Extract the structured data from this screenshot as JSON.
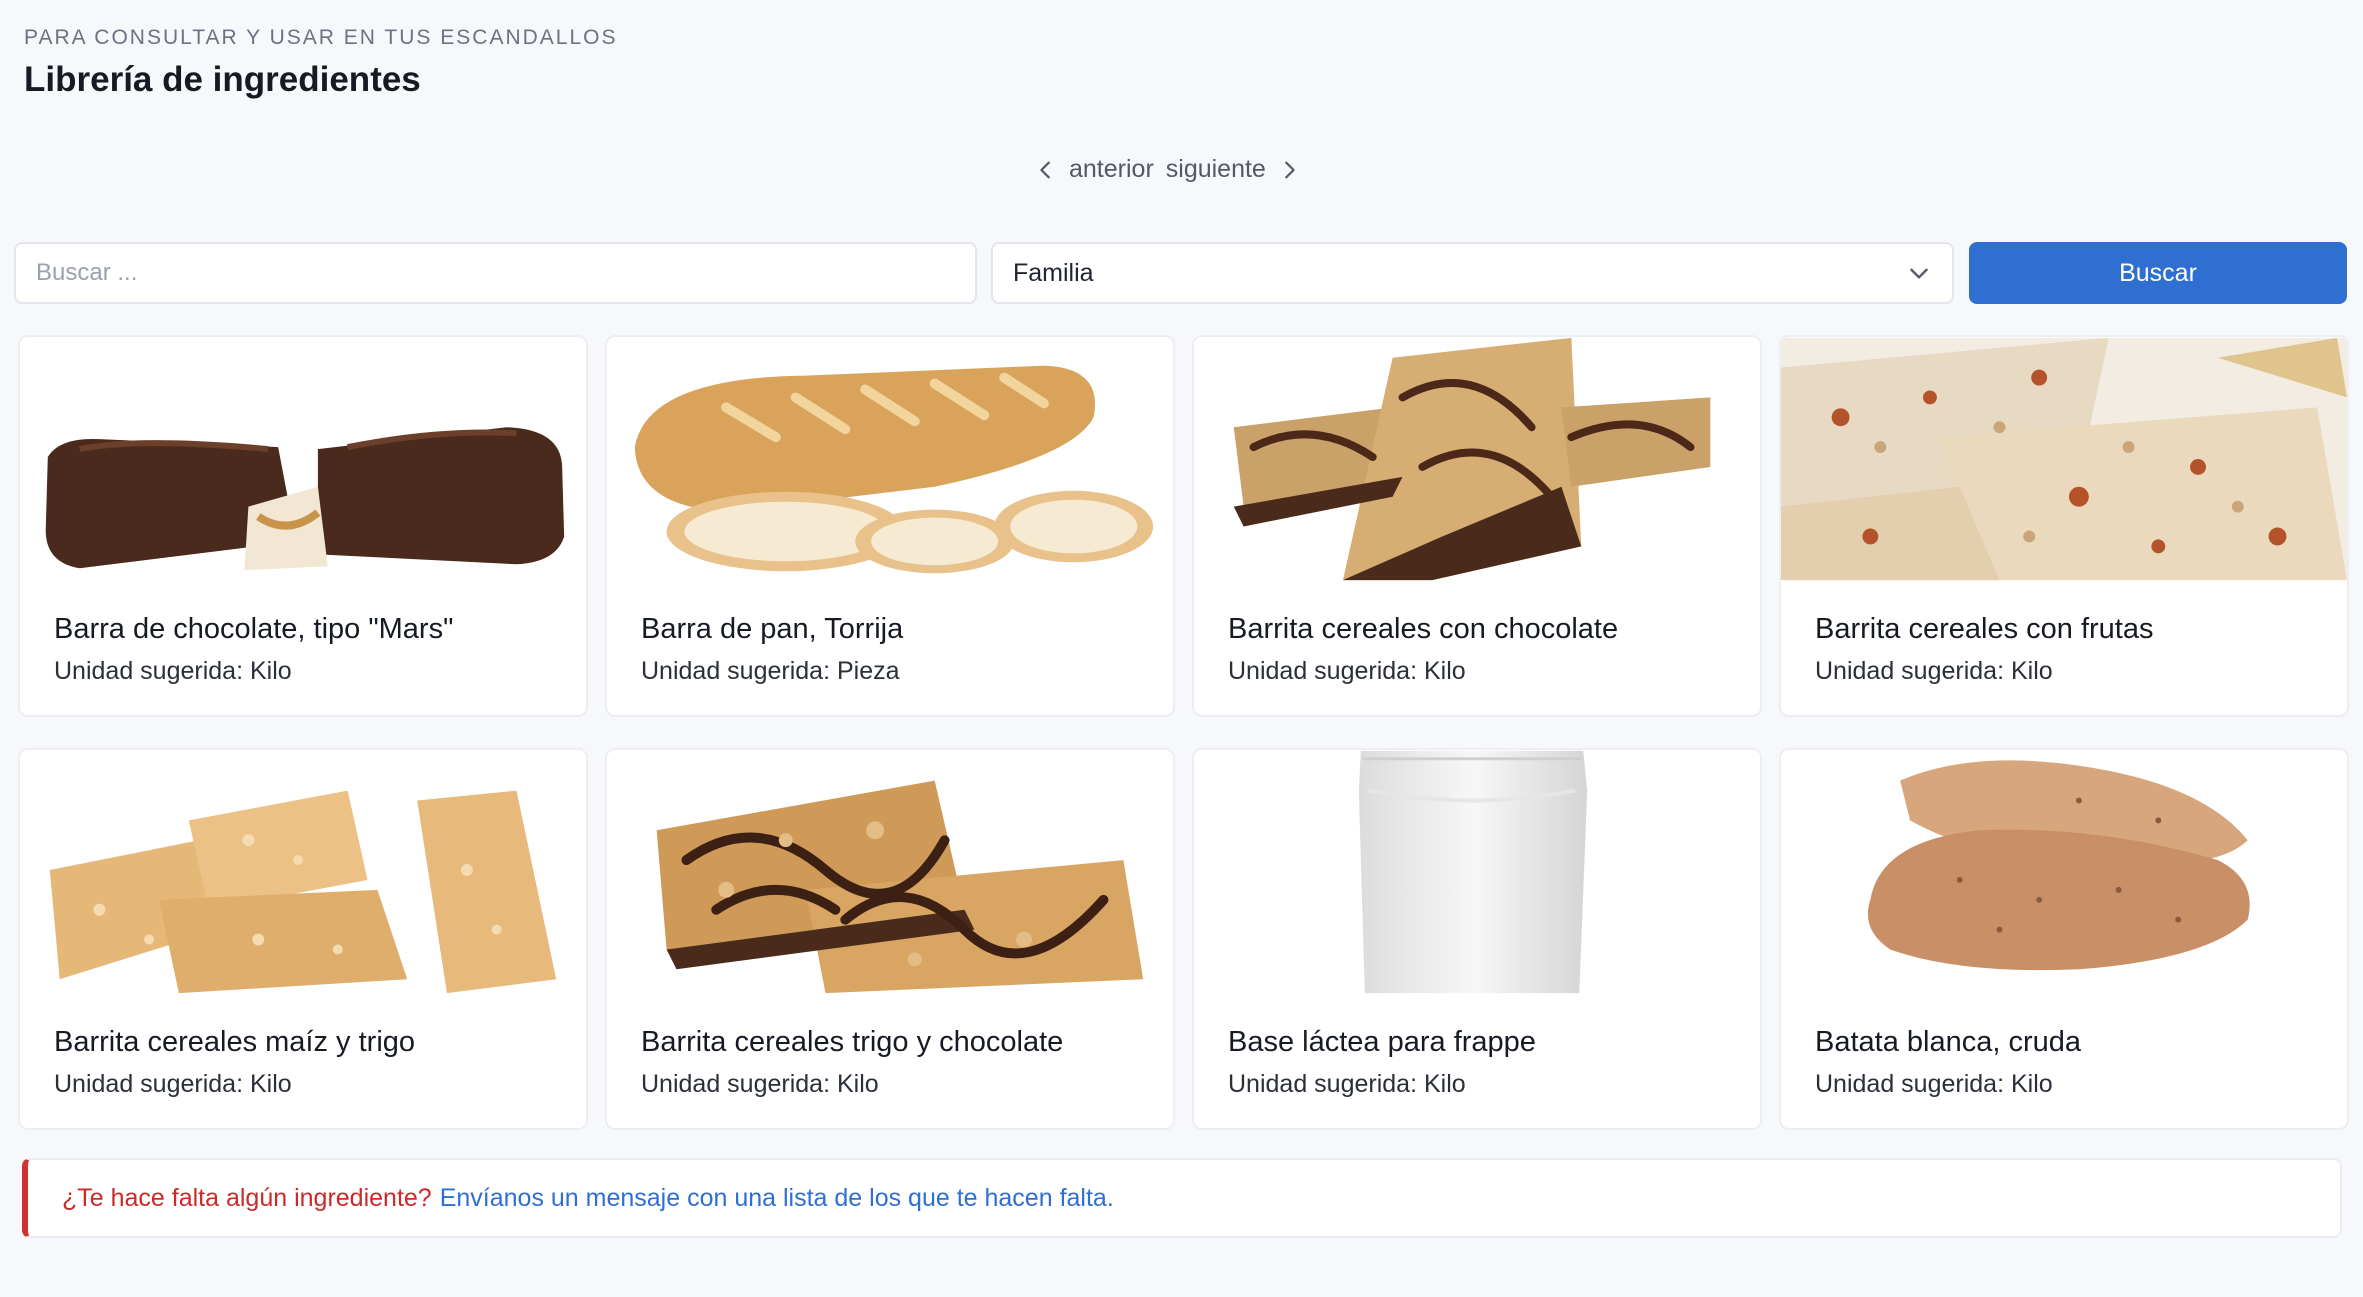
{
  "header": {
    "eyebrow": "PARA CONSULTAR Y USAR EN TUS ESCANDALLOS",
    "title": "Librería de ingredientes"
  },
  "pager": {
    "prev_label": "anterior",
    "next_label": "siguiente"
  },
  "search": {
    "placeholder": "Buscar ...",
    "value": "",
    "family_selected": "Familia",
    "button_label": "Buscar"
  },
  "cards": [
    {
      "title": "Barra de chocolate, tipo \"Mars\"",
      "unit": "Unidad sugerida: Kilo",
      "image": "chocolate-bar"
    },
    {
      "title": "Barra de pan, Torrija",
      "unit": "Unidad sugerida: Pieza",
      "image": "bread-loaf"
    },
    {
      "title": "Barrita cereales con chocolate",
      "unit": "Unidad sugerida: Kilo",
      "image": "cereal-bar-chocolate"
    },
    {
      "title": "Barrita cereales con frutas",
      "unit": "Unidad sugerida: Kilo",
      "image": "cereal-bar-fruit"
    },
    {
      "title": "Barrita cereales maíz y trigo",
      "unit": "Unidad sugerida: Kilo",
      "image": "cereal-bar-corn-wheat"
    },
    {
      "title": "Barrita cereales trigo y chocolate",
      "unit": "Unidad sugerida: Kilo",
      "image": "cereal-bar-wheat-chocolate"
    },
    {
      "title": "Base láctea para frappe",
      "unit": "Unidad sugerida: Kilo",
      "image": "white-pouch"
    },
    {
      "title": "Batata blanca, cruda",
      "unit": "Unidad sugerida: Kilo",
      "image": "sweet-potato"
    }
  ],
  "notice": {
    "question": "¿Te hace falta algún ingrediente?",
    "link_text": "Envíanos un mensaje con una lista de los que te hacen falta."
  },
  "colors": {
    "background": "#f6f8fb",
    "accent": "#2e6fd1",
    "alert": "#cc2a27"
  },
  "icons": [
    "chevron-left-icon",
    "chevron-right-icon",
    "chevron-down-icon"
  ]
}
